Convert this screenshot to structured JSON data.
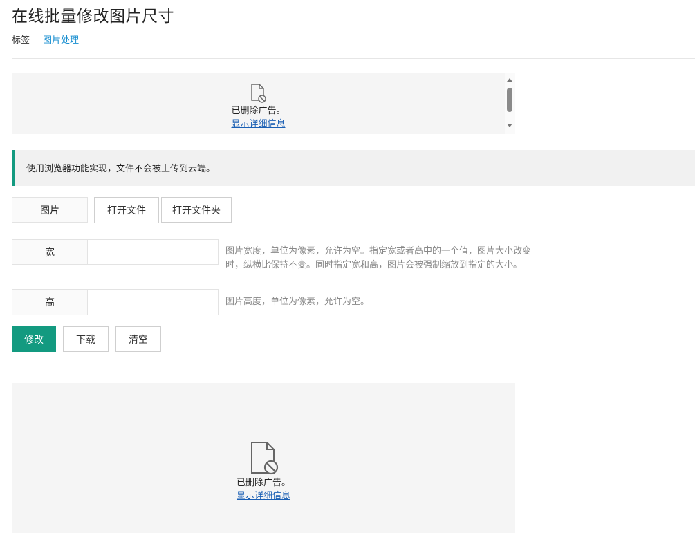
{
  "header": {
    "title": "在线批量修改图片尺寸",
    "tags_label": "标签",
    "tag_link": "图片处理"
  },
  "ads": {
    "top": {
      "icon": "blocked-file-icon",
      "text": "已删除广告。",
      "link": "显示详细信息"
    },
    "bottom": {
      "icon": "blocked-file-icon",
      "text": "已删除广告。",
      "link": "显示详细信息"
    }
  },
  "notice": {
    "text": "使用浏览器功能实现，文件不会被上传到云端。",
    "accent_color": "#139a80"
  },
  "form": {
    "image": {
      "label": "图片",
      "open_file": "打开文件",
      "open_folder": "打开文件夹"
    },
    "width": {
      "label": "宽",
      "value": "",
      "hint_line1": "图片宽度，单位为像素，允许为空。指定宽或者高中的一个值，图片大小改变",
      "hint_line2": "时，纵横比保持不变。同时指定宽和高，图片会被强制缩放到指定的大小。"
    },
    "height": {
      "label": "高",
      "value": "",
      "hint": "图片高度，单位为像素，允许为空。"
    }
  },
  "actions": {
    "modify": "修改",
    "download": "下载",
    "clear": "清空",
    "primary_color": "#139a80"
  }
}
